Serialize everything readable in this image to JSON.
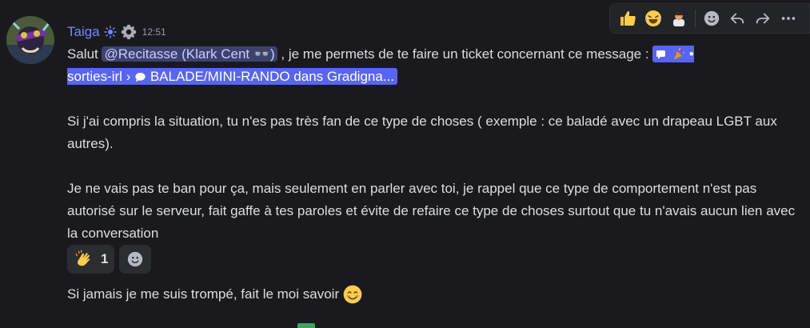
{
  "message": {
    "author": "Taiga",
    "timestamp": "12:51",
    "author_icon": "sun-icon",
    "badge_icon": "gear-icon",
    "line1_prefix": "Salut ",
    "mention": "@Recitasse (Klark Cent 👓)",
    "line1_suffix": " , je me permets de te faire un ticket concernant ce message : ",
    "channel_link": {
      "channel": "sorties-irl",
      "separator": "›",
      "thread": "BALADE/MINI-RANDO dans Gradigna..."
    },
    "para2": "Si j'ai compris la situation, tu n'es pas très fan de ce type de choses ( exemple : ce baladé avec un drapeau LGBT aux autres).",
    "para3": "Je ne vais pas te ban pour ça, mais seulement en parler avec toi, je rappel que ce type de comportement n'est pas autorisé sur le serveur, fait gaffe à tes paroles et évite de refaire ce type de choses surtout que tu n'avais aucun lien avec la conversation",
    "followup": "Si jamais je me suis trompé, fait le moi savoir"
  },
  "reactions": [
    {
      "emoji": "clapping-hands-emoji",
      "count": "1"
    }
  ],
  "hover_bar": {
    "items": [
      "thumbs-up-emoji",
      "joy-emoji",
      "person-emoji",
      "add-reaction-icon",
      "reply-icon",
      "forward-icon",
      "more-icon"
    ]
  },
  "colors": {
    "background": "#1a1a1e",
    "author": "#7289ff",
    "mention_bg": "#3c4270",
    "channel_link_bg": "#5865f2",
    "text": "#dbdee1"
  }
}
